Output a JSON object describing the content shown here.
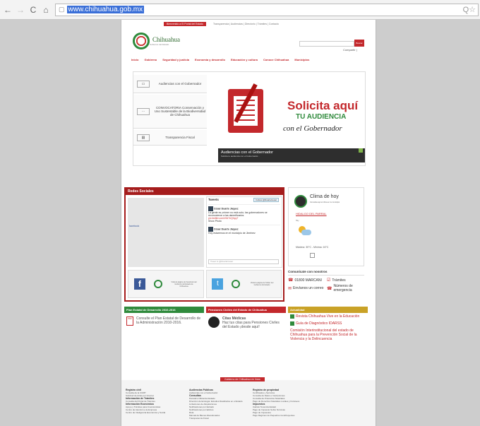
{
  "browser": {
    "back": "←",
    "forward": "→",
    "reload": "C",
    "home": "⌂",
    "url": "www.chihuahua.gob.mx",
    "star": "Q☆"
  },
  "header": {
    "bienvenido": "Bienvenido a El Portal del Estado",
    "toplinks": "Transparencia  |  Audiencias  |  Directorio  |  Trámites  |  Contacto",
    "logo_title": "Chihuahua",
    "logo_sub": "Gobierno del Estado",
    "search_button": "Buscar",
    "compartir": "Compartir |"
  },
  "nav": [
    "Inicio",
    "Gobierno",
    "Seguridad y justicia",
    "Economía y desarrollo",
    "Educación y cultura",
    "Conoce Chihuahua",
    "Municipios"
  ],
  "sidebar": [
    {
      "label": "Audiencias con el Gobernador"
    },
    {
      "label": "CONVOCATORIA Conservación y Uso Sustentable de la Biodiversidad de Chihuahua"
    },
    {
      "label": "Transparencia Fiscal"
    }
  ],
  "banner": {
    "line1": "Solicita aquí",
    "line2": "TU AUDIENCIA",
    "line3": "con el Gobernador",
    "caption_title": "Audiencias con el Gobernador",
    "caption_sub": "Solicita tu audiencia con el Gobernador..."
  },
  "redes": {
    "title": "Redes Sociales",
    "facebook_text": "facebook",
    "tweets_title": "Tweets",
    "follow": "Follow @DuarteCesar",
    "tweet1_user": "César Duarte Jáquez",
    "tweet1_text": "La gente es ¡mimer no está solo; las gobernadores se reconocieron a las damnificados.",
    "tweet1_link": "pic.twitter.com/r9d7nQhpy7",
    "tweet1_action": "Show Photo",
    "tweet2_user": "César Duarte Jáquez",
    "tweet2_text": "Hoy estaremos en el municipio de Jiménez",
    "tweet_placeholder": "Tweet to @DuarteCesar",
    "fb_caption": "Visita la página de Facebook del Gobierno del Estado de Chihuahua",
    "tw_caption": "Visita la página de Twitter del Gobierno del Estado"
  },
  "clima": {
    "title": "Clima de hoy",
    "subtitle": "Consulta aquí el clima en tu municipio",
    "link": "HIDALGO DEL PARRAL",
    "date": "Hoy",
    "temp": "Máxima: 30°C - Mínima: 16°C"
  },
  "comunicate": {
    "title": "Comunícate con nosotros",
    "items": [
      {
        "icon": "☎",
        "label": "01800 MARCANI"
      },
      {
        "icon": "☑",
        "label": "Trámites"
      },
      {
        "icon": "✉",
        "label": "Envíanos un correo"
      },
      {
        "icon": "☎",
        "label": "Números de emergencia"
      }
    ]
  },
  "columns": {
    "plan_title": "Plan Estatal de Desarrollo 2010-2016",
    "plan_text": "Consulte el Plan Estatal de Desarrollo de la Administración 2010-2016.",
    "pensiones_title": "Pensiones Civiles del Estado de Chihuahua",
    "pensiones_heading": "Citas Médicas",
    "pensiones_text": "Haz tus citas para Pensiones Civiles del Estado ¡desde aquí!",
    "actualidad_title": "Actualidad",
    "actualidad_items": [
      "Revista Chihuahua Vive en la Educación",
      "Guía de Diagnóstico IDARSS",
      "Comisión Interinstitucional del estado de Chihuahua para la Prevención Social de la Violencia y la Delincuencia"
    ]
  },
  "footer": {
    "tab": "Gobierno de Chihuahua en línea",
    "col1": [
      "Registro civil",
      "Consulta de la CURP",
      "Solicitud de Actas por Internet",
      "Información de Trámites",
      "Consulta del Portal de Trámites",
      "Información Económica",
      "Apoyo y Trámites para Inversionistas",
      "Centro de Atención a la Empresa",
      "Centro de Inteligencia Económica y Social"
    ],
    "col2": [
      "Audiencias Públicas",
      "Audiencias con el Gobernador",
      "Consultas",
      "Periódico Oficial del Estado",
      "Dirección de Ecología: Estudios Realizados en el Estado",
      "Licitaciones de Adquisiciones",
      "Notificaciones por Estrado",
      "Notificaciones por Edictos",
      "Ruta",
      "Manual de Bienes Abandonados",
      "Transparencia Fiscal"
    ],
    "col3": [
      "Registro de propiedad",
      "Certificados y Servicios",
      "Consulta de Datos e Inscripciones",
      "Consulta de Protocolos Notariales",
      "Pago de Derechos Notariales Locales y Foráneos",
      "Impuestos",
      "Cálculo Tenencia Estatal",
      "Pago de Impuesto Sobre Nóminas",
      "Pago de Impuestos",
      "Pago Régimen de Pequeños Contribuyentes"
    ]
  },
  "colors": {
    "red": "#c3282c",
    "green": "#2f8a3c",
    "gold": "#c9a227"
  }
}
